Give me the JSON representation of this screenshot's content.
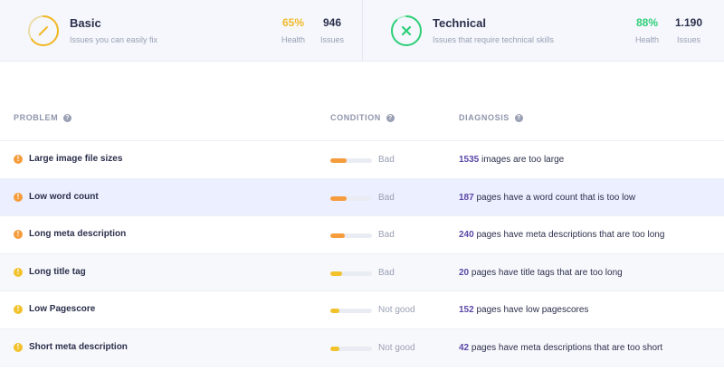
{
  "categories": [
    {
      "title": "Basic",
      "subtitle": "Issues you can easily fix",
      "health": "65%",
      "health_label": "Health",
      "issues": "946",
      "issues_label": "Issues",
      "health_fraction": 0.65,
      "color": "#f2b927",
      "icon": "pencil-icon"
    },
    {
      "title": "Technical",
      "subtitle": "Issues that require technical skills",
      "health": "88%",
      "health_label": "Health",
      "issues": "1.190",
      "issues_label": "Issues",
      "health_fraction": 0.88,
      "color": "#2fcf78",
      "icon": "wrench-cross-icon"
    }
  ],
  "table": {
    "headers": {
      "problem": "PROBLEM",
      "condition": "CONDITION",
      "diagnosis": "DIAGNOSIS"
    },
    "rows": [
      {
        "problem": "Large image file sizes",
        "condition": "Bad",
        "level": 0.4,
        "bar_color": "#f59c3c",
        "count": "1535",
        "diagnosis": " images are too large",
        "warn_color": "#f59c3c"
      },
      {
        "problem": "Low word count",
        "condition": "Bad",
        "level": 0.4,
        "bar_color": "#f59c3c",
        "count": "187",
        "diagnosis": " pages have a word count that is too low",
        "warn_color": "#f59c3c"
      },
      {
        "problem": "Long meta description",
        "condition": "Bad",
        "level": 0.35,
        "bar_color": "#f59c3c",
        "count": "240",
        "diagnosis": " pages have meta descriptions that are too long",
        "warn_color": "#f59c3c"
      },
      {
        "problem": "Long title tag",
        "condition": "Bad",
        "level": 0.28,
        "bar_color": "#f2c22b",
        "count": "20",
        "diagnosis": " pages have title tags that are too long",
        "warn_color": "#f2c22b"
      },
      {
        "problem": "Low Pagescore",
        "condition": "Not good",
        "level": 0.22,
        "bar_color": "#f2c22b",
        "count": "152",
        "diagnosis": " pages have low pagescores",
        "warn_color": "#f2c22b"
      },
      {
        "problem": "Short meta description",
        "condition": "Not good",
        "level": 0.22,
        "bar_color": "#f2c22b",
        "count": "42",
        "diagnosis": " pages have meta descriptions that are too short",
        "warn_color": "#f2c22b"
      }
    ]
  }
}
